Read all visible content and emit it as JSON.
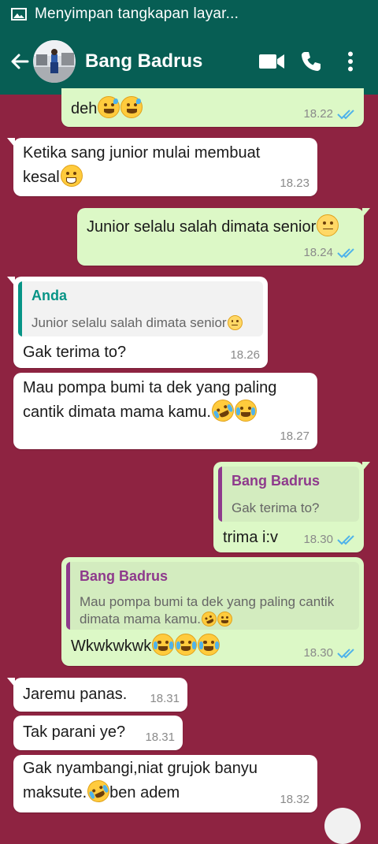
{
  "status": {
    "text": "Menyimpan tangkapan layar..."
  },
  "header": {
    "name": "Bang Badrus"
  },
  "colors": {
    "app_bar": "#075e54",
    "chat_bg": "#8e2341",
    "incoming": "#ffffff",
    "outgoing": "#dcf8c6",
    "read_tick": "#4fb3ea",
    "quote_out_name": "#8e3a8c",
    "quote_in_name": "#079486"
  },
  "messages": [
    {
      "dir": "out",
      "text": "deh",
      "emoji": [
        "sweat-smile-emoji",
        "sweat-smile-emoji"
      ],
      "time": "18.22",
      "read": true
    },
    {
      "dir": "in",
      "text1": "Ketika sang junior mulai membuat",
      "text2": "kesal",
      "emoji": [
        "triumph-emoji"
      ],
      "time": "18.23"
    },
    {
      "dir": "out",
      "text": "Junior selalu salah dimata senior",
      "emoji": [
        "neutral-emoji"
      ],
      "time": "18.24",
      "read": true
    },
    {
      "dir": "in",
      "quote": {
        "name": "Anda",
        "text": "Junior selalu salah dimata senior"
      },
      "text": "Gak terima to?",
      "time": "18.26"
    },
    {
      "dir": "in",
      "text1": "Mau pompa bumi ta dek yang paling",
      "text2": "cantik dimata mama kamu.",
      "emoji": [
        "rofl-emoji",
        "joy-emoji"
      ],
      "time": "18.27"
    },
    {
      "dir": "out",
      "quote": {
        "name": "Bang Badrus",
        "text": "Gak terima to?"
      },
      "text": "trima i:v",
      "time": "18.30",
      "read": true
    },
    {
      "dir": "out",
      "quote": {
        "name": "Bang Badrus",
        "text1": "Mau pompa bumi ta dek yang paling cantik",
        "text2": "dimata mama kamu."
      },
      "text": "Wkwkwkwk",
      "emoji": [
        "joy-emoji",
        "joy-emoji",
        "joy-emoji"
      ],
      "time": "18.30",
      "read": true
    },
    {
      "dir": "in",
      "text": "Jaremu panas.",
      "time": "18.31"
    },
    {
      "dir": "in",
      "text": "Tak parani ye?",
      "time": "18.31"
    },
    {
      "dir": "in",
      "text1": "Gak nyambangi,niat grujok banyu",
      "text2a": "maksute.",
      "text2b": "ben adem",
      "emoji": [
        "rofl-emoji"
      ],
      "time": "18.32"
    }
  ]
}
